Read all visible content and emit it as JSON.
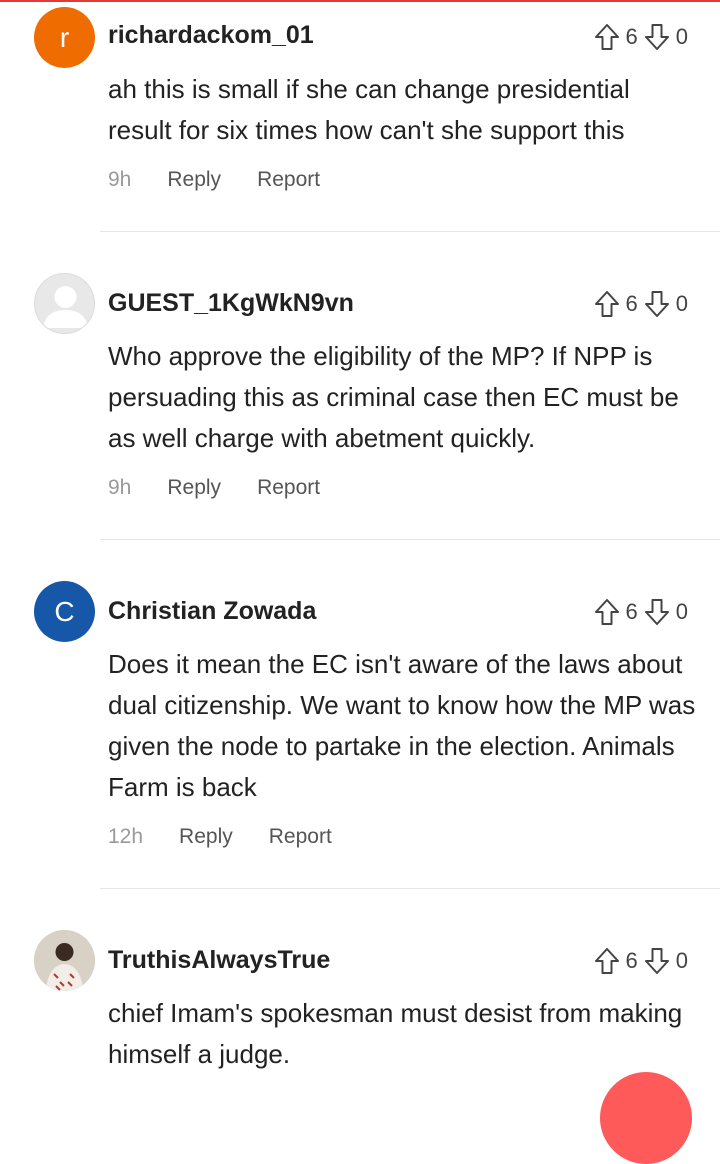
{
  "colors": {
    "accent": "#e53935",
    "avatar_orange": "#ef6c00",
    "avatar_blue": "#1657a8",
    "avatar_guest": "#dcdcdc",
    "fab": "#ff5a5a"
  },
  "comments": [
    {
      "avatar_letter": "r",
      "username": "richardackom_01",
      "upvotes": "6",
      "downvotes": "0",
      "text": "ah this is small if she can change presidential result for six times how can't she support this",
      "time": "9h",
      "reply_label": "Reply",
      "report_label": "Report"
    },
    {
      "avatar_letter": "",
      "username": "GUEST_1KgWkN9vn",
      "upvotes": "6",
      "downvotes": "0",
      "text": "Who approve the eligibility of the MP? If NPP is persuading this as criminal case then EC must be as well charge with abetment quickly.",
      "time": "9h",
      "reply_label": "Reply",
      "report_label": "Report"
    },
    {
      "avatar_letter": "C",
      "username": "Christian Zowada",
      "upvotes": "6",
      "downvotes": "0",
      "text": "Does it mean the EC isn't aware of the laws about dual citizenship. We want to know how the MP was given the node to partake in the election. Animals Farm is back",
      "time": "12h",
      "reply_label": "Reply",
      "report_label": "Report"
    },
    {
      "avatar_letter": "",
      "username": "TruthisAlwaysTrue",
      "upvotes": "6",
      "downvotes": "0",
      "text": "chief Imam's spokesman must desist from making himself a judge.",
      "time": "",
      "reply_label": "",
      "report_label": ""
    }
  ]
}
